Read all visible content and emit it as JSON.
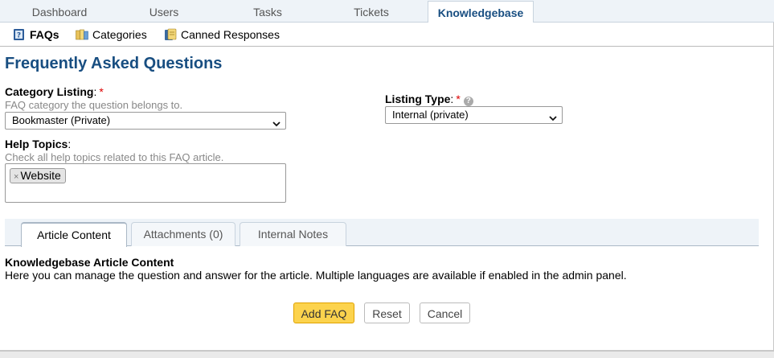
{
  "nav": {
    "tabs": [
      {
        "label": "Dashboard"
      },
      {
        "label": "Users"
      },
      {
        "label": "Tasks"
      },
      {
        "label": "Tickets"
      },
      {
        "label": "Knowledgebase"
      }
    ],
    "active_tab": "Knowledgebase"
  },
  "subnav": {
    "items": [
      {
        "label": "FAQs",
        "icon": "faq-book-icon"
      },
      {
        "label": "Categories",
        "icon": "categories-icon"
      },
      {
        "label": "Canned Responses",
        "icon": "canned-responses-icon"
      }
    ],
    "active_item": "FAQs"
  },
  "page": {
    "title": "Frequently Asked Questions"
  },
  "form": {
    "category": {
      "label": "Category Listing",
      "colon": ":",
      "required_mark": "*",
      "hint": "FAQ category the question belongs to.",
      "value": "Bookmaster (Private)"
    },
    "listing_type": {
      "label": "Listing Type",
      "colon": ":",
      "required_mark": "*",
      "help": "?",
      "value": "Internal (private)"
    },
    "help_topics": {
      "label": "Help Topics",
      "colon": ":",
      "hint": "Check all help topics related to this FAQ article.",
      "tokens": [
        {
          "label": "Website",
          "remove": "×"
        }
      ]
    }
  },
  "tabs": [
    {
      "label": "Article Content"
    },
    {
      "label": "Attachments (0)"
    },
    {
      "label": "Internal Notes"
    }
  ],
  "active_content_tab": "Article Content",
  "content": {
    "title": "Knowledgebase Article Content",
    "description": "Here you can manage the question and answer for the article. Multiple languages are available if enabled in the admin panel."
  },
  "buttons": {
    "add": "Add FAQ",
    "reset": "Reset",
    "cancel": "Cancel"
  },
  "colors": {
    "title": "#184e81",
    "primary_button": "#fcd34d",
    "required": "#dd0000"
  }
}
